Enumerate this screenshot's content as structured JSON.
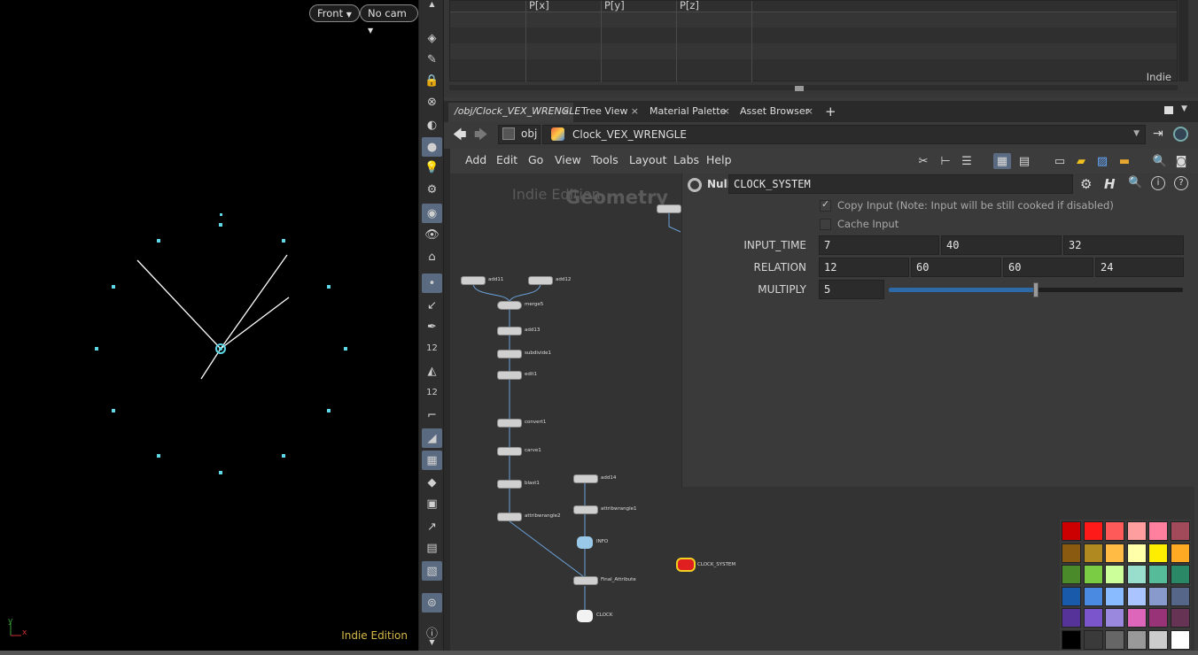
{
  "viewport": {
    "view_menu": "Front",
    "cam_menu": "No cam",
    "watermark": "Indie Edition",
    "axis_y": "y",
    "axis_x": "x",
    "color": "#5fd8e8"
  },
  "spreadsheet": {
    "columns": [
      "P[x]",
      "P[y]",
      "P[z]"
    ],
    "watermark": "Indie"
  },
  "tabs": [
    {
      "label": "/obj/Clock_VEX_WRENGLE",
      "close": "×"
    },
    {
      "label": "Tree View",
      "close": "×"
    },
    {
      "label": "Material Palette",
      "close": "×"
    },
    {
      "label": "Asset Browser",
      "close": "×"
    },
    {
      "label": "+",
      "close": ""
    }
  ],
  "path": {
    "root": "obj",
    "node": "Clock_VEX_WRENGLE"
  },
  "menu": [
    "Add",
    "Edit",
    "Go",
    "View",
    "Tools",
    "Layout",
    "Labs",
    "Help"
  ],
  "network": {
    "watermark": "Indie Edition",
    "context": "Geometry",
    "nodes": [
      {
        "name": "add11"
      },
      {
        "name": "add12"
      },
      {
        "name": "merge5"
      },
      {
        "name": "add13"
      },
      {
        "name": "subdivide1"
      },
      {
        "name": "edit1"
      },
      {
        "name": "convert1"
      },
      {
        "name": "carve1"
      },
      {
        "name": "blast1"
      },
      {
        "name": "attribwrangle2"
      },
      {
        "name": "add14"
      },
      {
        "name": "attribwrangle1"
      },
      {
        "name": "INFO"
      },
      {
        "name": "Final_Attribute"
      },
      {
        "name": "CLOCK"
      },
      {
        "name": "CLOCK_SYSTEM"
      }
    ]
  },
  "params": {
    "node_type": "Null",
    "node_name": "CLOCK_SYSTEM",
    "copy_input": "Copy Input (Note: Input will be still cooked if disabled)",
    "cache_input": "Cache Input",
    "input_time": {
      "label": "INPUT_TIME",
      "values": [
        "7",
        "40",
        "32"
      ]
    },
    "relation": {
      "label": "RELATION",
      "values": [
        "12",
        "60",
        "60",
        "24"
      ]
    },
    "multiply": {
      "label": "MULTIPLY",
      "value": "5",
      "slider_fraction": 0.5
    }
  },
  "palette": [
    [
      "#cc0000",
      "#ff1a1a",
      "#ff5a5a",
      "#ff9e9e",
      "#ff7f9e",
      "#a24a5a"
    ],
    [
      "#8a5a10",
      "#b08a20",
      "#ffbb44",
      "#ffffaa",
      "#ffee00",
      "#ffaa22"
    ],
    [
      "#4a8a2a",
      "#7acc44",
      "#ccff99",
      "#99ddcc",
      "#55bb99",
      "#2a8866"
    ],
    [
      "#1a5aaa",
      "#4a8ae0",
      "#88bbff",
      "#aac4ff",
      "#8899cc",
      "#556688"
    ],
    [
      "#553399",
      "#7a55cc",
      "#9988dd",
      "#dd66bb",
      "#993377",
      "#663355"
    ],
    [
      "#000000",
      "#3a3a3a",
      "#666666",
      "#999999",
      "#cccccc",
      "#ffffff"
    ]
  ]
}
